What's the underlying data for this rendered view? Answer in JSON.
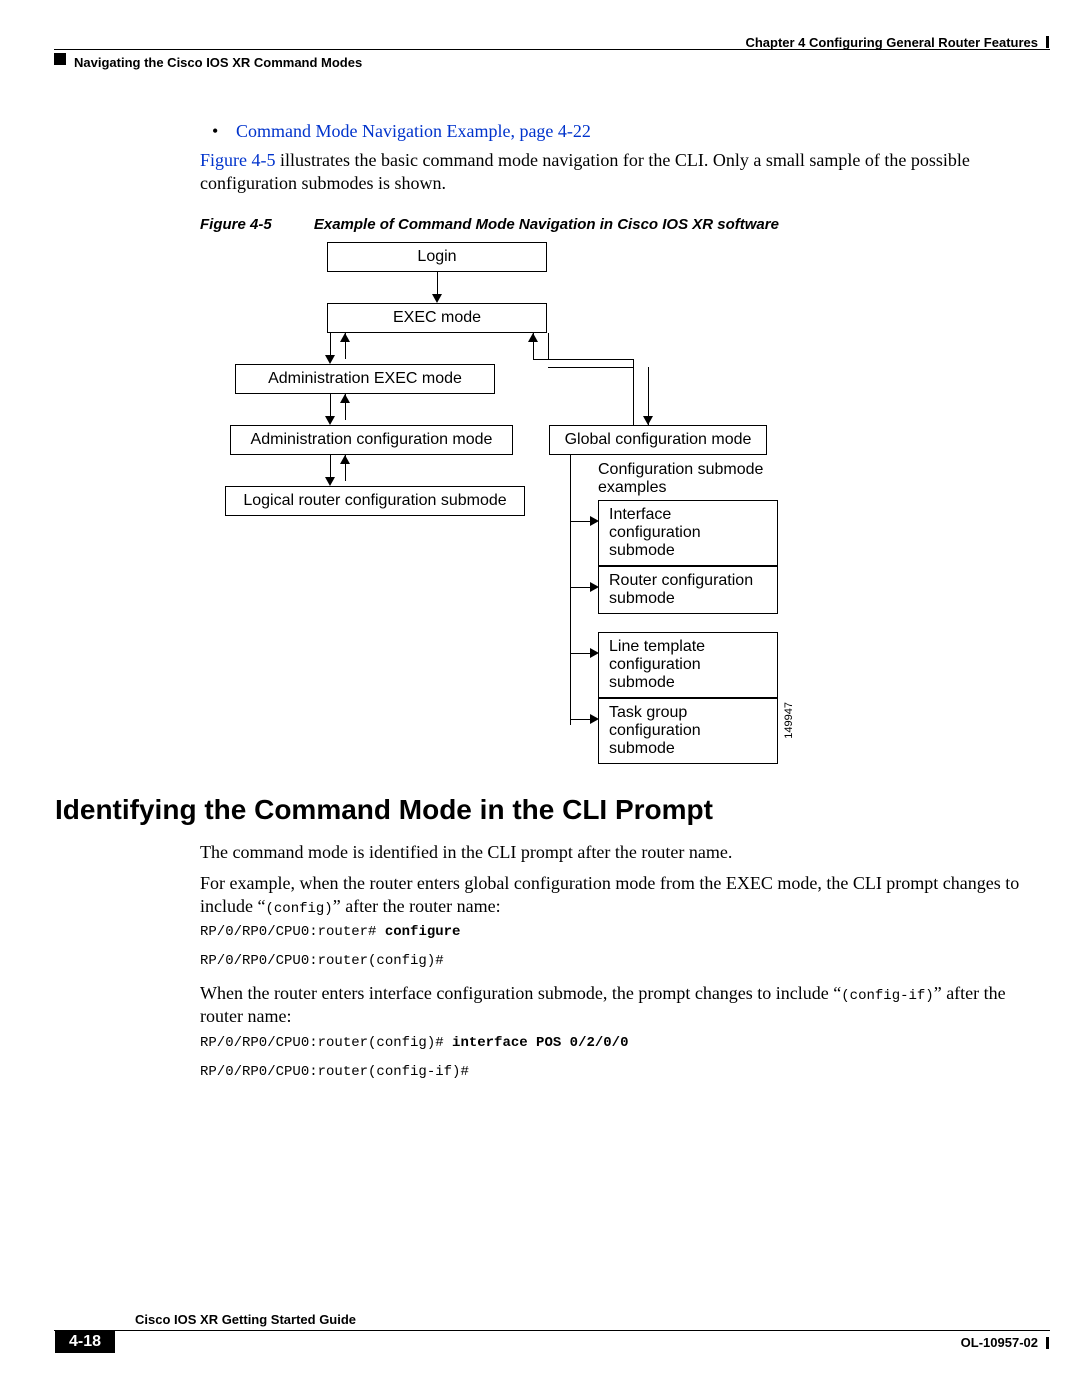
{
  "header": {
    "chapter": "Chapter 4    Configuring General Router Features",
    "section": "Navigating the Cisco IOS XR Command Modes"
  },
  "bullet_link": "Command Mode Navigation Example, page 4-22",
  "para1_linkref": "Figure 4-5",
  "para1_rest": " illustrates the basic command mode navigation for the CLI. Only a small sample of the possible configuration submodes is shown.",
  "figure": {
    "caption_num": "Figure 4-5",
    "caption_title": "Example of Command Mode Navigation in Cisco IOS XR software",
    "id_number": "149947"
  },
  "chart_data": {
    "type": "diagram",
    "nodes": [
      {
        "id": "login",
        "label": "Login"
      },
      {
        "id": "exec",
        "label": "EXEC mode"
      },
      {
        "id": "admin_exec",
        "label": "Administration EXEC mode"
      },
      {
        "id": "admin_cfg",
        "label": "Administration configuration mode"
      },
      {
        "id": "lr_cfg_sub",
        "label": "Logical router configuration submode"
      },
      {
        "id": "global_cfg",
        "label": "Global configuration mode"
      },
      {
        "id": "sub_iface",
        "label": "Interface configuration submode"
      },
      {
        "id": "sub_router",
        "label": "Router configuration submode"
      },
      {
        "id": "sub_line",
        "label": "Line template configuration submode"
      },
      {
        "id": "sub_task",
        "label": "Task group configuration submode"
      }
    ],
    "group_label": "Configuration submode examples",
    "edges": [
      {
        "from": "login",
        "to": "exec",
        "dir": "down"
      },
      {
        "from": "exec",
        "to": "admin_exec",
        "dir": "both"
      },
      {
        "from": "exec",
        "to": "global_cfg",
        "dir": "both"
      },
      {
        "from": "admin_exec",
        "to": "admin_cfg",
        "dir": "both"
      },
      {
        "from": "admin_cfg",
        "to": "lr_cfg_sub",
        "dir": "both"
      },
      {
        "from": "global_cfg",
        "to": "sub_iface",
        "dir": "right"
      },
      {
        "from": "global_cfg",
        "to": "sub_router",
        "dir": "right"
      },
      {
        "from": "global_cfg",
        "to": "sub_line",
        "dir": "right"
      },
      {
        "from": "global_cfg",
        "to": "sub_task",
        "dir": "right"
      }
    ]
  },
  "h2": "Identifying the Command Mode in the CLI Prompt",
  "para2": "The command mode is identified in the CLI prompt after the router name.",
  "para3_a": "For example, when the router enters global configuration mode from the EXEC mode, the CLI prompt changes to include “",
  "para3_code": "(config)",
  "para3_b": "” after the router name:",
  "code1_a": "RP/0/RP0/CPU0:router# ",
  "code1_b": "configure",
  "code2": "RP/0/RP0/CPU0:router(config)#",
  "para4_a": "When the router enters interface configuration submode, the prompt changes to include “",
  "para4_code": "(config-if)",
  "para4_b": "” after the router name:",
  "code3_a": "RP/0/RP0/CPU0:router(config)# ",
  "code3_b": "interface POS 0/2/0/0",
  "code4": "RP/0/RP0/CPU0:router(config-if)#",
  "footer": {
    "guide": "Cisco IOS XR Getting Started Guide",
    "page": "4-18",
    "doc": "OL-10957-02"
  }
}
